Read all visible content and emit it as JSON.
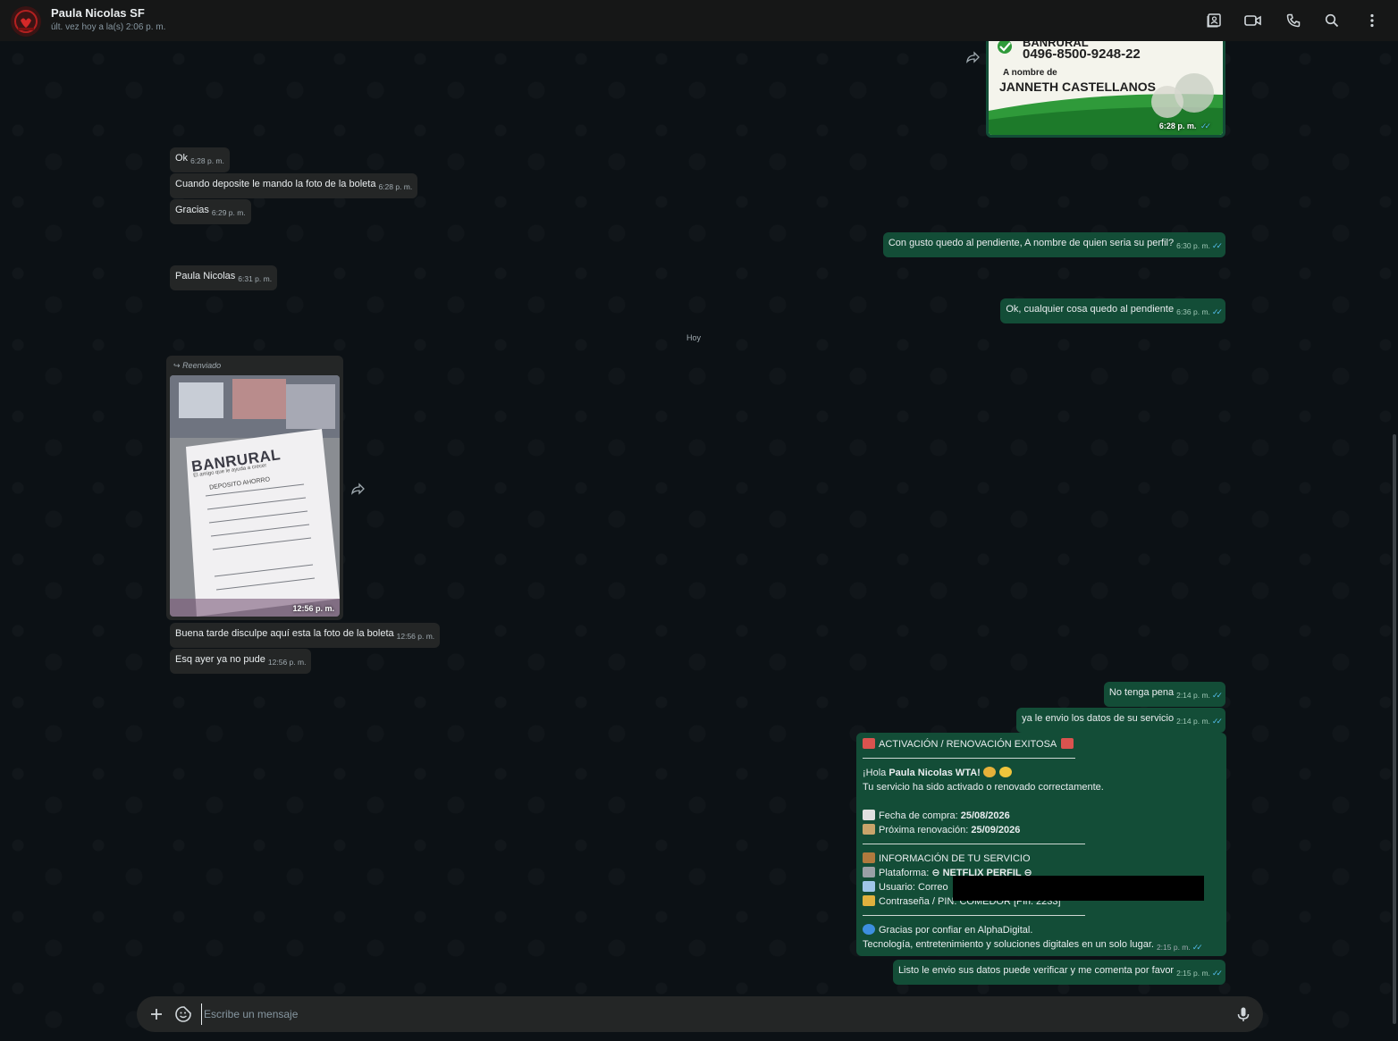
{
  "header": {
    "contact_name": "Paula Nicolas SF",
    "last_seen": "últ. vez hoy a la(s) 2:06 p. m.",
    "icons": [
      "contact-card-icon",
      "video-call-icon",
      "phone-icon",
      "search-icon",
      "more-options-icon"
    ]
  },
  "top_image": {
    "bank_name": "BANRURAL",
    "account_number": "0496-8500-9248-22",
    "label": "A nombre de",
    "holder": "JANNETH CASTELLANOS",
    "time": "6:28 p. m."
  },
  "messages_in_1": [
    {
      "text": "Ok",
      "time": "6:28 p. m."
    },
    {
      "text": "Cuando deposite le mando la foto de la boleta",
      "time": "6:28 p. m."
    },
    {
      "text": "Gracias",
      "time": "6:29 p. m."
    }
  ],
  "msg_out_1": {
    "text": "Con gusto quedo al pendiente, A nombre de quien seria su perfil?",
    "time": "6:30 p. m."
  },
  "msg_in_2": {
    "text": "Paula Nicolas",
    "time": "6:31 p. m."
  },
  "msg_out_2": {
    "text": "Ok, cualquier cosa quedo al pendiente",
    "time": "6:36 p. m."
  },
  "date_chip": "Hoy",
  "receipt": {
    "forwarded_label": "Reenviado",
    "bank": "BANRURAL",
    "slogan": "El amigo que le ayuda a crecer",
    "type": "DEPOSITO AHORRO",
    "time": "12:56 p. m."
  },
  "messages_in_3": [
    {
      "text": "Buena tarde disculpe aquí esta la foto de la boleta",
      "time": "12:56 p. m."
    },
    {
      "text": "Esq ayer ya no pude",
      "time": "12:56 p. m."
    }
  ],
  "messages_out_3": [
    {
      "text": "No tenga pena",
      "time": "2:14 p. m."
    },
    {
      "text": "ya le envio los datos de su servicio",
      "time": "2:14 p. m."
    }
  ],
  "activation": {
    "title": "ACTIVACIÓN / RENOVACIÓN EXITOSA",
    "greeting_prefix": "¡Hola ",
    "greeting_name": "Paula Nicolas WTA!",
    "status": "Tu servicio ha sido activado o renovado correctamente.",
    "purchase_label": "Fecha de compra: ",
    "purchase_date": "25/08/2026",
    "renewal_label": "Próxima renovación: ",
    "renewal_date": "25/09/2026",
    "info_title": "INFORMACIÓN DE TU SERVICIO",
    "platform_label": "Plataforma: ",
    "platform_value": "NETFLIX PERFIL",
    "user_label": "Usuario: Correo",
    "password_label": "Contraseña / PIN: COMEDOR [Pin: 2233]",
    "thanks": "Gracias por confiar en AlphaDigital.",
    "tagline": "Tecnología, entretenimiento y soluciones digitales en un solo lugar.",
    "time": "2:15 p. m."
  },
  "msg_out_final": {
    "text": "Listo le envio sus datos puede verificar y me comenta por favor",
    "time": "2:15 p. m."
  },
  "compose": {
    "placeholder": "Escribe un mensaje"
  },
  "colors": {
    "incoming_bubble": "#242626",
    "outgoing_bubble": "#134d37",
    "read_ticks": "#53bdeb",
    "header": "#161717"
  }
}
